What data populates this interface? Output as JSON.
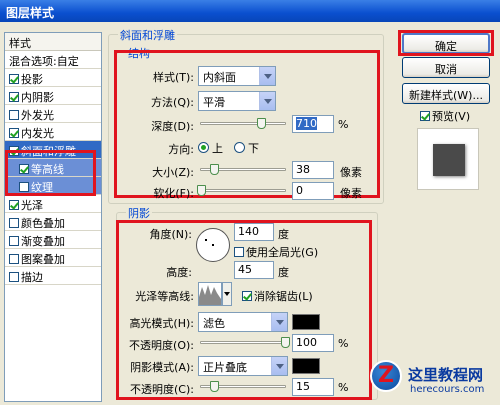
{
  "window": {
    "title": "图层样式"
  },
  "styles_panel": {
    "header": "样式",
    "items": [
      {
        "label": "混合选项:自定",
        "checkbox": false,
        "checked": false
      },
      {
        "label": "投影",
        "checkbox": true,
        "checked": true
      },
      {
        "label": "内阴影",
        "checkbox": true,
        "checked": true
      },
      {
        "label": "外发光",
        "checkbox": true,
        "checked": false
      },
      {
        "label": "内发光",
        "checkbox": true,
        "checked": true
      },
      {
        "label": "斜面和浮雕",
        "checkbox": true,
        "checked": true
      },
      {
        "label": "等高线",
        "checkbox": true,
        "checked": true
      },
      {
        "label": "纹理",
        "checkbox": true,
        "checked": false
      },
      {
        "label": "光泽",
        "checkbox": true,
        "checked": true
      },
      {
        "label": "颜色叠加",
        "checkbox": true,
        "checked": false
      },
      {
        "label": "渐变叠加",
        "checkbox": true,
        "checked": false
      },
      {
        "label": "图案叠加",
        "checkbox": true,
        "checked": false
      },
      {
        "label": "描边",
        "checkbox": true,
        "checked": false
      }
    ]
  },
  "bevel": {
    "group_title": "斜面和浮雕",
    "section_title": "结构",
    "style_label": "样式(T):",
    "style_value": "内斜面",
    "technique_label": "方法(Q):",
    "technique_value": "平滑",
    "depth_label": "深度(D):",
    "depth_value": "710",
    "depth_unit": "%",
    "depth_slider": 0.71,
    "direction_label": "方向:",
    "direction_up": "上",
    "direction_down": "下",
    "direction_selected": "up",
    "size_label": "大小(Z):",
    "size_value": "38",
    "size_unit": "像素",
    "size_slider": 0.15,
    "soften_label": "软化(F):",
    "soften_value": "0",
    "soften_unit": "像素",
    "soften_slider": 0.0
  },
  "shading": {
    "section_title": "阴影",
    "angle_label": "角度(N):",
    "angle_value": "140",
    "angle_unit": "度",
    "global_light_label": "使用全局光(G)",
    "global_light_checked": false,
    "altitude_label": "高度:",
    "altitude_value": "45",
    "altitude_unit": "度",
    "gloss_label": "光泽等高线:",
    "antialias_label": "消除锯齿(L)",
    "antialias_checked": true,
    "highlight_mode_label": "高光模式(H):",
    "highlight_mode_value": "滤色",
    "highlight_color": "#000000",
    "highlight_opacity_label": "不透明度(O):",
    "highlight_opacity_value": "100",
    "highlight_opacity_unit": "%",
    "highlight_opacity_slider": 1.0,
    "shadow_mode_label": "阴影模式(A):",
    "shadow_mode_value": "正片叠底",
    "shadow_color": "#000000",
    "shadow_opacity_label": "不透明度(C):",
    "shadow_opacity_value": "15",
    "shadow_opacity_unit": "%",
    "shadow_opacity_slider": 0.15
  },
  "buttons": {
    "ok": "确定",
    "cancel": "取消",
    "new_style": "新建样式(W)...",
    "preview_label": "预览(V)",
    "preview_checked": true
  },
  "watermark": {
    "logo_letter": "Z",
    "title": "这里教程网",
    "url": "herecours.com"
  },
  "colors": {
    "highlight_red": "#e0141e",
    "selection_blue": "#316ac5",
    "legend_blue": "#0046d5"
  }
}
